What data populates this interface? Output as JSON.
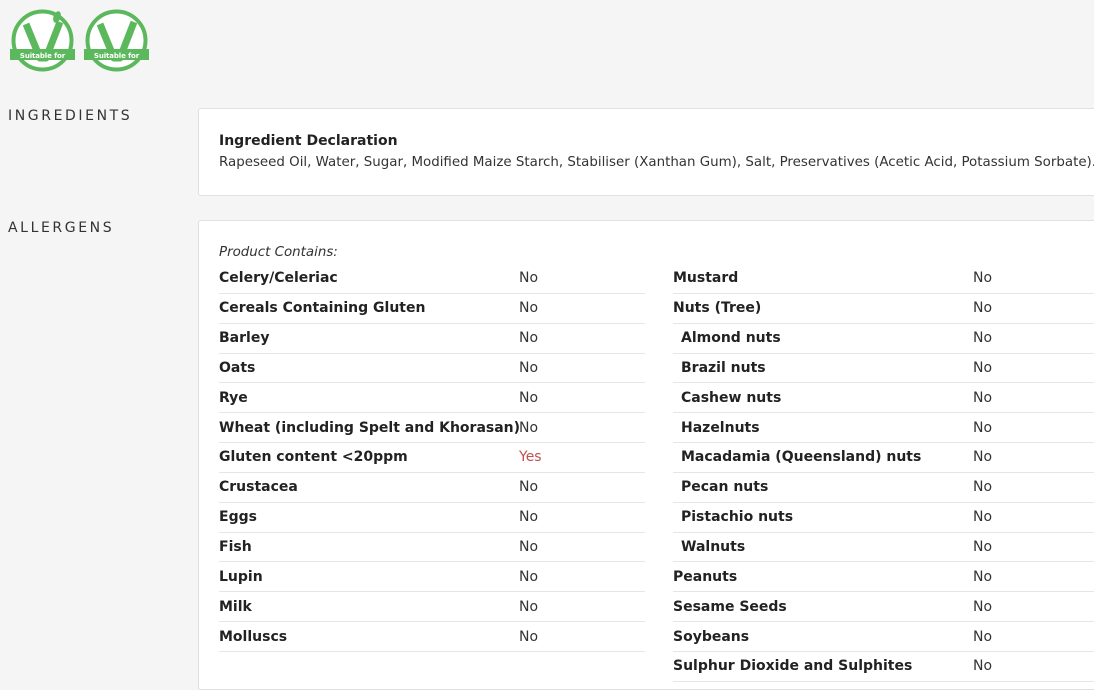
{
  "badges": [
    {
      "icon": "vegetarian-v-icon",
      "text": "Suitable for",
      "color": "#5cb85c"
    },
    {
      "icon": "vegan-v-icon",
      "text": "Suitable for",
      "color": "#5cb85c"
    }
  ],
  "ingredients": {
    "label": "INGREDIENTS",
    "title": "Ingredient Declaration",
    "text": "Rapeseed Oil, Water, Sugar, Modified Maize Starch, Stabiliser (Xanthan Gum), Salt, Preservatives (Acetic Acid, Potassium Sorbate)."
  },
  "allergens": {
    "label": "ALLERGENS",
    "contains_label": "Product Contains:",
    "left": [
      {
        "name": "Celery/Celeriac",
        "value": "No"
      },
      {
        "name": "Cereals Containing Gluten",
        "value": "No"
      },
      {
        "name": "Barley",
        "value": "No"
      },
      {
        "name": "Oats",
        "value": "No"
      },
      {
        "name": "Rye",
        "value": "No"
      },
      {
        "name": "Wheat (including Spelt and Khorasan)",
        "value": "No"
      },
      {
        "name": "Gluten content <20ppm",
        "value": "Yes"
      },
      {
        "name": "Crustacea",
        "value": "No"
      },
      {
        "name": "Eggs",
        "value": "No"
      },
      {
        "name": "Fish",
        "value": "No"
      },
      {
        "name": "Lupin",
        "value": "No"
      },
      {
        "name": "Milk",
        "value": "No"
      },
      {
        "name": "Molluscs",
        "value": "No"
      }
    ],
    "right": [
      {
        "name": "Mustard",
        "value": "No"
      },
      {
        "name": "Nuts (Tree)",
        "value": "No"
      },
      {
        "name": "Almond nuts",
        "value": "No",
        "indent": true
      },
      {
        "name": "Brazil nuts",
        "value": "No",
        "indent": true
      },
      {
        "name": "Cashew nuts",
        "value": "No",
        "indent": true
      },
      {
        "name": "Hazelnuts",
        "value": "No",
        "indent": true
      },
      {
        "name": "Macadamia (Queensland) nuts",
        "value": "No",
        "indent": true
      },
      {
        "name": "Pecan nuts",
        "value": "No",
        "indent": true
      },
      {
        "name": "Pistachio nuts",
        "value": "No",
        "indent": true
      },
      {
        "name": "Walnuts",
        "value": "No",
        "indent": true
      },
      {
        "name": "Peanuts",
        "value": "No"
      },
      {
        "name": "Sesame Seeds",
        "value": "No"
      },
      {
        "name": "Soybeans",
        "value": "No"
      },
      {
        "name": "Sulphur Dioxide and Sulphites",
        "value": "No"
      }
    ]
  }
}
